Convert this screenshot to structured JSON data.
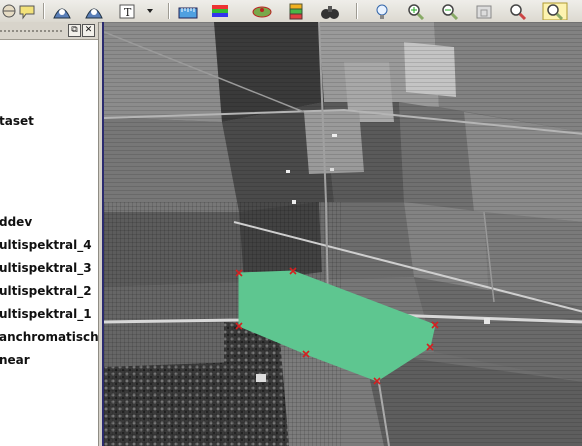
{
  "legend": {
    "items": [
      {
        "label": "taset"
      },
      {
        "label": "ddev"
      },
      {
        "label": "ultispektral_4"
      },
      {
        "label": "ultispektral_3"
      },
      {
        "label": "ultispektral_2"
      },
      {
        "label": "ultispektral_1"
      },
      {
        "label": "anchromatisch"
      },
      {
        "label": "near"
      }
    ]
  },
  "panel": {
    "float_glyph": "⧉",
    "close_glyph": "✕"
  },
  "toolbar_icons": [
    "add-layer-icon",
    "annotation-icon",
    "identify-icon",
    "identify-results-icon",
    "text-annotation-icon",
    "measure-icon",
    "color-legend-icon",
    "vector-layer-icon",
    "stack-layers-icon",
    "binoculars-icon",
    "lightbulb-icon",
    "zoom-in-icon",
    "zoom-out-icon",
    "zoom-layer-icon",
    "zoom-full-icon",
    "zoom-last-icon"
  ],
  "colors": {
    "polygon_fill": "#5ec690",
    "vertex_marker": "#d42020",
    "map_border": "#2b2b6e"
  }
}
